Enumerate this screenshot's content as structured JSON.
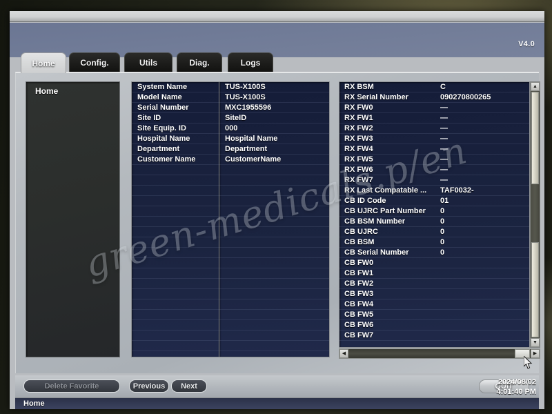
{
  "app": {
    "version_label": "V4.0",
    "watermark": "green-medicals.p/en"
  },
  "tabs": [
    {
      "label": "Home",
      "active": true
    },
    {
      "label": "Config.",
      "active": false
    },
    {
      "label": "Utils",
      "active": false
    },
    {
      "label": "Diag.",
      "active": false
    },
    {
      "label": "Logs",
      "active": false
    }
  ],
  "tree": {
    "items": [
      {
        "label": "Home"
      }
    ]
  },
  "system_info": {
    "rows": [
      {
        "label": "System Name",
        "value": "TUS-X100S"
      },
      {
        "label": "Model Name",
        "value": "TUS-X100S"
      },
      {
        "label": "Serial Number",
        "value": "MXC1955596"
      },
      {
        "label": "Site ID",
        "value": "SiteID"
      },
      {
        "label": "Site Equip. ID",
        "value": "000"
      },
      {
        "label": "Hospital Name",
        "value": "Hospital Name"
      },
      {
        "label": "Department",
        "value": "Department"
      },
      {
        "label": "Customer Name",
        "value": "CustomerName"
      }
    ]
  },
  "device_info": {
    "rows": [
      {
        "label": "RX BSM",
        "value": "C"
      },
      {
        "label": "RX Serial Number",
        "value": "090270800265"
      },
      {
        "label": "RX FW0",
        "value": "—"
      },
      {
        "label": "RX FW1",
        "value": "—"
      },
      {
        "label": "RX FW2",
        "value": "—"
      },
      {
        "label": "RX FW3",
        "value": "—"
      },
      {
        "label": "RX FW4",
        "value": "—"
      },
      {
        "label": "RX FW5",
        "value": "—"
      },
      {
        "label": "RX FW6",
        "value": "—"
      },
      {
        "label": "RX FW7",
        "value": "—"
      },
      {
        "label": "RX Last Compatable ...",
        "value": "TAF0032-"
      },
      {
        "label": "CB ID Code",
        "value": "01"
      },
      {
        "label": "CB UJRC Part Number",
        "value": "0"
      },
      {
        "label": "CB BSM Number",
        "value": "0"
      },
      {
        "label": "CB UJRC",
        "value": "0"
      },
      {
        "label": "CB BSM",
        "value": "0"
      },
      {
        "label": "CB Serial Number",
        "value": "0"
      },
      {
        "label": "CB FW0",
        "value": ""
      },
      {
        "label": "CB FW1",
        "value": ""
      },
      {
        "label": "CB FW2",
        "value": ""
      },
      {
        "label": "CB FW3",
        "value": ""
      },
      {
        "label": "CB FW4",
        "value": ""
      },
      {
        "label": "CB FW5",
        "value": ""
      },
      {
        "label": "CB FW6",
        "value": ""
      },
      {
        "label": "CB FW7",
        "value": ""
      }
    ]
  },
  "scrollbars": {
    "vertical": {
      "up_arrow": "▲",
      "down_arrow": "▼"
    },
    "horizontal": {
      "left_arrow": "◀",
      "right_arrow": "▶"
    }
  },
  "buttons": {
    "delete_favorite": "Delete Favorite",
    "previous": "Previous",
    "next": "Next",
    "quit": "QUIT"
  },
  "statusbar": {
    "text": "Home"
  },
  "clock": {
    "date": "2024/08/02",
    "time": "4:01:40 PM"
  }
}
